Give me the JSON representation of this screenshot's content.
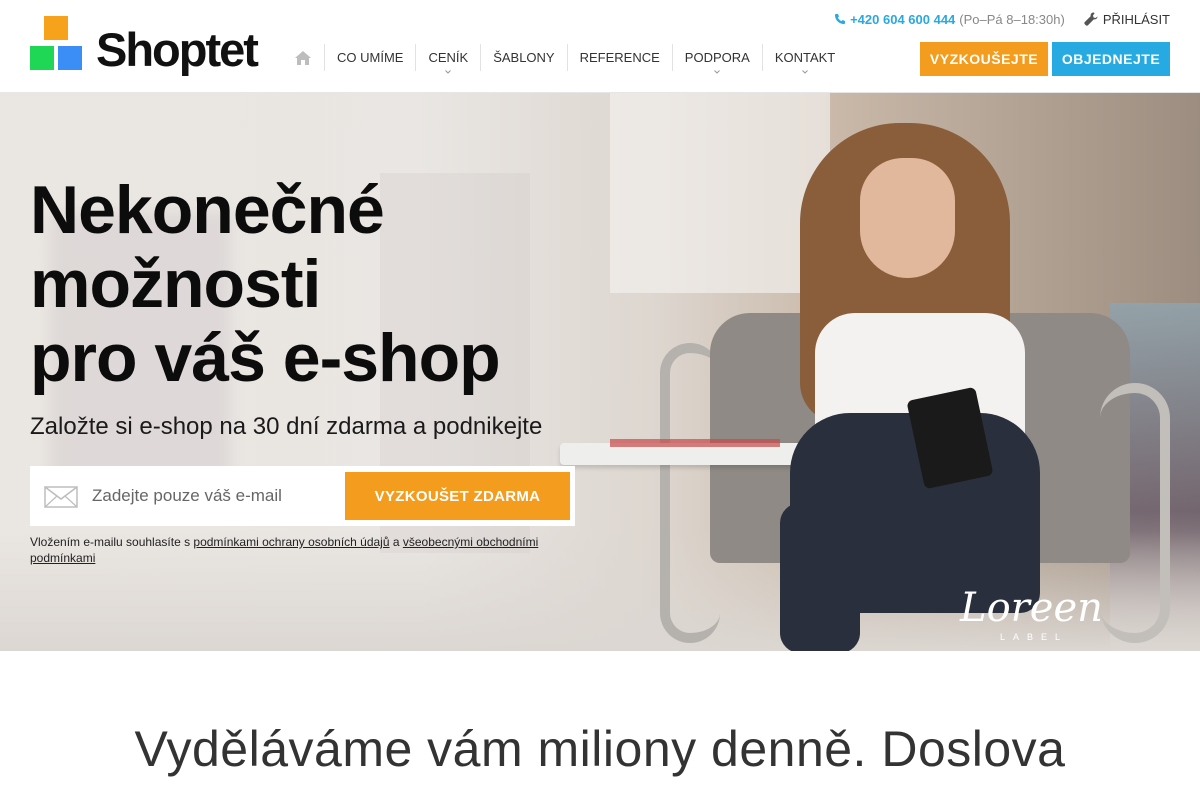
{
  "brand": {
    "name": "Shoptet"
  },
  "topbar": {
    "phone_number": "+420 604 600 444",
    "phone_hours": "(Po–Pá 8–18:30h)",
    "login_label": "PŘIHLÁSIT"
  },
  "nav": {
    "items": [
      {
        "label": "CO UMÍME",
        "has_dropdown": false
      },
      {
        "label": "CENÍK",
        "has_dropdown": true
      },
      {
        "label": "ŠABLONY",
        "has_dropdown": false
      },
      {
        "label": "REFERENCE",
        "has_dropdown": false
      },
      {
        "label": "PODPORA",
        "has_dropdown": true
      },
      {
        "label": "KONTAKT",
        "has_dropdown": true
      }
    ]
  },
  "header_buttons": {
    "try_label": "VYZKOUŠEJTE",
    "order_label": "OBJEDNEJTE"
  },
  "hero": {
    "headline_line1": "Nekonečné",
    "headline_line2": "možnosti",
    "headline_line3": "pro váš e-shop",
    "subheadline": "Založte si e-shop na 30 dní zdarma a podnikejte",
    "email_placeholder": "Zadejte pouze váš e-mail",
    "submit_label": "VYZKOUŠET ZDARMA",
    "consent_prefix": "Vložením e-mailu souhlasíte s ",
    "consent_link1": "podmínkami ochrany osobních údajů",
    "consent_middle": " a ",
    "consent_link2": "všeobecnými obchodními podmínkami",
    "photo_brand_script": "Loreen",
    "photo_brand_label": "LABEL"
  },
  "section": {
    "title": "Vyděláváme vám miliony denně. Doslova"
  },
  "colors": {
    "orange": "#f39c1e",
    "blue": "#27a9e1",
    "logo_orange": "#f7a21b",
    "logo_green": "#1fd655",
    "logo_blue": "#3a8ef6"
  },
  "icons": [
    "phone-icon",
    "wrench-icon",
    "home-icon",
    "mail-icon",
    "chevron-down-icon"
  ]
}
